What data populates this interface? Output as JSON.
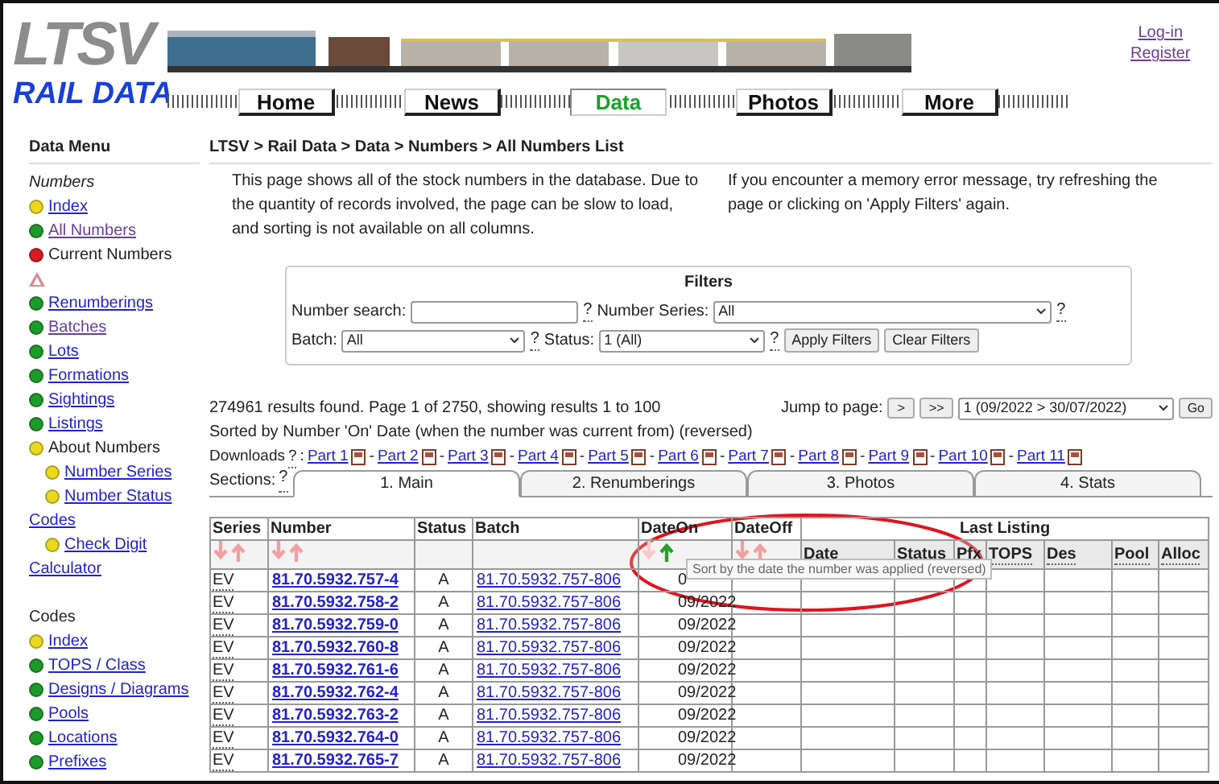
{
  "header": {
    "logo": "LTSV",
    "subtitle": "RAIL DATA",
    "nav": [
      {
        "label": "Home",
        "selected": false
      },
      {
        "label": "News",
        "selected": false
      },
      {
        "label": "Data",
        "selected": true
      },
      {
        "label": "Photos",
        "selected": false
      },
      {
        "label": "More",
        "selected": false
      }
    ],
    "account_links": [
      "Log-in",
      "Register"
    ]
  },
  "sidebar": {
    "title": "Data Menu",
    "sections": [
      {
        "heading": "Numbers",
        "italic": true,
        "items": [
          {
            "kind": "link",
            "label": "Index",
            "color": "#e8d820",
            "visited": false
          },
          {
            "kind": "link",
            "label": "All Numbers",
            "color": "#1e9a2a",
            "visited": true
          },
          {
            "kind": "text",
            "label": "Current Numbers",
            "color": "#d41c1c"
          },
          {
            "kind": "warning"
          },
          {
            "kind": "link",
            "label": "Renumberings",
            "color": "#1e9a2a",
            "visited": false
          },
          {
            "kind": "link",
            "label": "Batches",
            "color": "#1e9a2a",
            "visited": true
          },
          {
            "kind": "link",
            "label": "Lots",
            "color": "#1e9a2a",
            "visited": false
          },
          {
            "kind": "link",
            "label": "Formations",
            "color": "#1e9a2a",
            "visited": false
          },
          {
            "kind": "link",
            "label": "Sightings",
            "color": "#1e9a2a",
            "visited": false
          },
          {
            "kind": "link",
            "label": "Listings",
            "color": "#1e9a2a",
            "visited": false
          },
          {
            "kind": "text",
            "label": "About Numbers",
            "color": "#e8d820",
            "children": [
              {
                "kind": "link",
                "label": "Number Series",
                "color": "#e8d820",
                "visited": false
              },
              {
                "kind": "link",
                "label": "Number Status",
                "color": "#e8d820",
                "visited": false
              }
            ]
          },
          {
            "kind": "link",
            "label": "Codes",
            "visited": false,
            "children": [
              {
                "kind": "link",
                "label": "Check Digit",
                "color": "#e8d820",
                "visited": false
              }
            ]
          },
          {
            "kind": "link",
            "label": "Calculator",
            "visited": false
          }
        ]
      },
      {
        "heading": "Codes",
        "italic": false,
        "items": [
          {
            "kind": "link",
            "label": "Index",
            "color": "#e8d820",
            "visited": false
          },
          {
            "kind": "link",
            "label": "TOPS / Class",
            "color": "#1e9a2a",
            "visited": false
          },
          {
            "kind": "link",
            "label": "Designs / Diagrams",
            "color": "#1e9a2a",
            "visited": false
          },
          {
            "kind": "link",
            "label": "Pools",
            "color": "#1e9a2a",
            "visited": false
          },
          {
            "kind": "link",
            "label": "Locations",
            "color": "#1e9a2a",
            "visited": false
          },
          {
            "kind": "link",
            "label": "Prefixes",
            "color": "#1e9a2a",
            "visited": false
          }
        ]
      }
    ]
  },
  "breadcrumb": "LTSV > Rail Data > Data > Numbers > All Numbers List",
  "intro": [
    "This page shows all of the stock numbers in the database. Due to the quantity of records involved, the page can be slow to load, and sorting is not available on all columns.",
    "If you encounter a memory error message, try refreshing the page or clicking on 'Apply Filters' again."
  ],
  "filters": {
    "title": "Filters",
    "help": "?",
    "number_search": {
      "label": "Number search:"
    },
    "number_series": {
      "label": "Number Series:",
      "value": "All"
    },
    "batch": {
      "label": "Batch:",
      "value": "All"
    },
    "status": {
      "label": "Status:",
      "value": "1 (All)"
    },
    "buttons": [
      "Apply Filters",
      "Clear Filters"
    ]
  },
  "results": {
    "summary": "274961 results found. Page 1 of 2750, showing results 1 to 100",
    "sort_note": "Sorted by Number 'On' Date (when the number was current from) (reversed)",
    "jump": {
      "label": "Jump to page:",
      "buttons": [
        ">",
        ">>"
      ],
      "value": "1 (09/2022 > 30/07/2022)",
      "go": "Go"
    }
  },
  "downloads": {
    "label": "Downloads",
    "help": "?",
    "colon": ":",
    "separator": "-",
    "parts": [
      "Part 1",
      "Part 2",
      "Part 3",
      "Part 4",
      "Part 5",
      "Part 6",
      "Part 7",
      "Part 8",
      "Part 9",
      "Part 10",
      "Part 11"
    ]
  },
  "sections": {
    "label": "Sections:",
    "help": "?",
    "tabs": [
      {
        "label": "1. Main",
        "selected": true
      },
      {
        "label": "2. Renumberings",
        "selected": false
      },
      {
        "label": "3. Photos",
        "selected": false
      },
      {
        "label": "4. Stats",
        "selected": false
      }
    ]
  },
  "table": {
    "columns": [
      {
        "label": "Series",
        "sort_selected": false
      },
      {
        "label": "Number",
        "sort_selected": false
      },
      {
        "label": "Status"
      },
      {
        "label": "Batch"
      },
      {
        "label": "DateOn",
        "sort_selected": true
      },
      {
        "label": "DateOff",
        "sort_selected": false
      }
    ],
    "group_heading": "Last Listing",
    "sub_columns": [
      "Date",
      "Status",
      "Pfx",
      "TOPS",
      "Des",
      "Pool",
      "Alloc"
    ],
    "rows": [
      {
        "series": "EV",
        "number": "81.70.5932.757-4",
        "status": "A",
        "batch": "81.70.5932.757-806",
        "date_on": "0"
      },
      {
        "series": "EV",
        "number": "81.70.5932.758-2",
        "status": "A",
        "batch": "81.70.5932.757-806",
        "date_on": "09/2022"
      },
      {
        "series": "EV",
        "number": "81.70.5932.759-0",
        "status": "A",
        "batch": "81.70.5932.757-806",
        "date_on": "09/2022"
      },
      {
        "series": "EV",
        "number": "81.70.5932.760-8",
        "status": "A",
        "batch": "81.70.5932.757-806",
        "date_on": "09/2022"
      },
      {
        "series": "EV",
        "number": "81.70.5932.761-6",
        "status": "A",
        "batch": "81.70.5932.757-806",
        "date_on": "09/2022"
      },
      {
        "series": "EV",
        "number": "81.70.5932.762-4",
        "status": "A",
        "batch": "81.70.5932.757-806",
        "date_on": "09/2022"
      },
      {
        "series": "EV",
        "number": "81.70.5932.763-2",
        "status": "A",
        "batch": "81.70.5932.757-806",
        "date_on": "09/2022"
      },
      {
        "series": "EV",
        "number": "81.70.5932.764-0",
        "status": "A",
        "batch": "81.70.5932.757-806",
        "date_on": "09/2022"
      },
      {
        "series": "EV",
        "number": "81.70.5932.765-7",
        "status": "A",
        "batch": "81.70.5932.757-806",
        "date_on": "09/2022"
      }
    ]
  },
  "tooltip": "Sort by the date the number was applied (reversed)"
}
